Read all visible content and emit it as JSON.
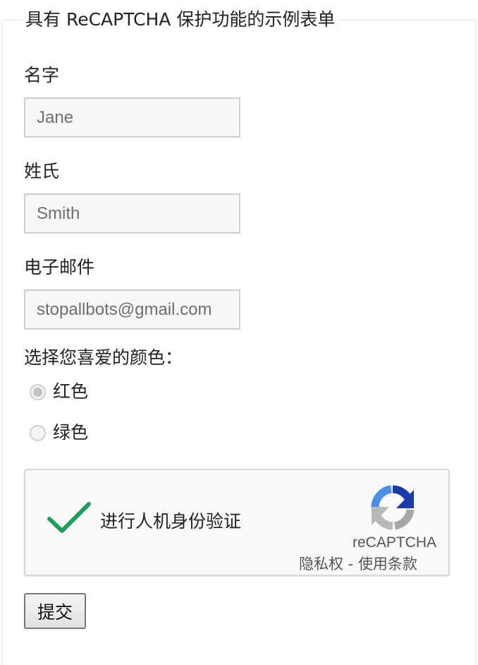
{
  "form": {
    "title": "具有 ReCAPTCHA 保护功能的示例表单",
    "first_name": {
      "label": "名字",
      "placeholder": "Jane"
    },
    "last_name": {
      "label": "姓氏",
      "placeholder": "Smith"
    },
    "email": {
      "label": "电子邮件",
      "placeholder": "stopallbots@gmail.com"
    },
    "color_question": "选择您喜爱的颜色：",
    "color_options": [
      {
        "label": "红色",
        "checked": true
      },
      {
        "label": "绿色",
        "checked": false
      }
    ],
    "submit_label": "提交"
  },
  "captcha": {
    "prompt": "进行人机身份验证",
    "brand": "reCAPTCHA",
    "privacy_label": "隐私权",
    "separator": " - ",
    "terms_label": "使用条款",
    "check_color": "#1e9e5a"
  }
}
